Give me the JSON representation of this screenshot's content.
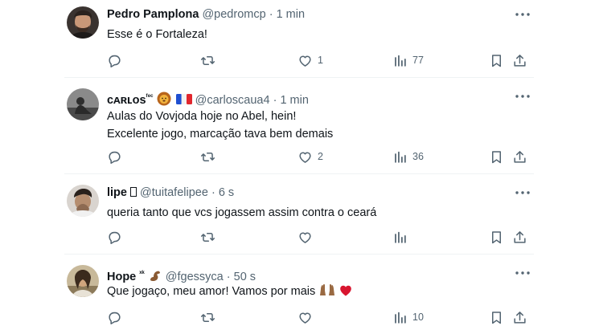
{
  "tweets": [
    {
      "name": "Pedro Pamplona",
      "handle": "@pedromcp",
      "dot": "·",
      "time": "1 min",
      "lines": [
        "Esse é o Fortaleza!"
      ],
      "counts": {
        "replies": "",
        "retweets": "",
        "likes": "1",
        "views": "77"
      },
      "avatar_color": "#3a3330"
    },
    {
      "name": "ᴄᴀʀʟᴏs",
      "name_sup": "ᶠᵉᶜ",
      "handle": "@carloscaua4",
      "dot": "·",
      "time": "1 min",
      "lines": [
        "Aulas do Vovjoda hoje no Abel, hein!",
        "Excelente jogo, marcação tava bem demais"
      ],
      "counts": {
        "replies": "",
        "retweets": "",
        "likes": "2",
        "views": "36"
      },
      "avatar_color": "#6e6e6e",
      "emoji_names": [
        "lion-emoji",
        "france-flag-emoji"
      ]
    },
    {
      "name": "lipe",
      "handle": "@tuitafelipee",
      "dot": "·",
      "time": "6 s",
      "lines": [
        "queria tanto que vcs jogassem assim contra o ceará"
      ],
      "counts": {
        "replies": "",
        "retweets": "",
        "likes": "",
        "views": ""
      },
      "avatar_color": "#9b8878"
    },
    {
      "name": "Hope",
      "name_sup": "ˣᵏ",
      "handle": "@fgessyca",
      "dot": "·",
      "time": "50 s",
      "lines": [
        "Que jogaço, meu amor! Vamos por mais"
      ],
      "counts": {
        "replies": "",
        "retweets": "",
        "likes": "",
        "views": "10"
      },
      "avatar_color": "#b9a585",
      "emoji_names": [
        "flexed-biceps-emoji",
        "raising-hands-emoji",
        "red-heart-emoji"
      ]
    }
  ],
  "colors": {
    "text": "#0f1419",
    "secondary": "#536471",
    "separator": "#eff3f4",
    "heart": "#e0245e"
  }
}
